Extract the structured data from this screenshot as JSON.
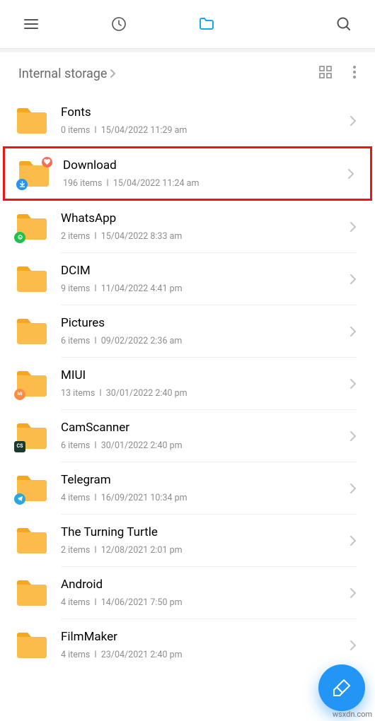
{
  "breadcrumb": "Internal storage",
  "folders": [
    {
      "name": "Fonts",
      "items": "0 items",
      "date": "15/04/2022 11:29 am",
      "badges": [],
      "highlighted": false
    },
    {
      "name": "Download",
      "items": "196 items",
      "date": "15/04/2022 11:24 am",
      "badges": [
        {
          "pos": "tr",
          "color": "#ff6b57",
          "icon": "heart"
        },
        {
          "pos": "bl",
          "color": "#2395f5",
          "icon": "download"
        }
      ],
      "highlighted": true
    },
    {
      "name": "WhatsApp",
      "items": "2 items",
      "date": "15/04/2022 8:33 am",
      "badges": [
        {
          "pos": "bl",
          "color": "#1ec14d",
          "icon": "whatsapp"
        }
      ],
      "highlighted": false
    },
    {
      "name": "DCIM",
      "items": "9 items",
      "date": "11/04/2022 4:41 pm",
      "badges": [],
      "highlighted": false
    },
    {
      "name": "Pictures",
      "items": "6 items",
      "date": "09/02/2022 2:36 am",
      "badges": [],
      "highlighted": false
    },
    {
      "name": "MIUI",
      "items": "13 items",
      "date": "30/01/2022 2:40 pm",
      "badges": [
        {
          "pos": "bl",
          "color": "#ff8c42",
          "icon": "miui"
        }
      ],
      "highlighted": false
    },
    {
      "name": "CamScanner",
      "items": "6 items",
      "date": "30/01/2022 2:40 pm",
      "badges": [
        {
          "pos": "bl",
          "color": "#1b3a2f",
          "icon": "cs"
        }
      ],
      "highlighted": false
    },
    {
      "name": "Telegram",
      "items": "4 items",
      "date": "16/09/2021 10:34 pm",
      "badges": [
        {
          "pos": "bl",
          "color": "#2ba7e0",
          "icon": "telegram"
        }
      ],
      "highlighted": false
    },
    {
      "name": "The Turning Turtle",
      "items": "2 items",
      "date": "12/08/2021 2:01 pm",
      "badges": [],
      "highlighted": false
    },
    {
      "name": "Android",
      "items": "4 items",
      "date": "14/06/2021 7:50 pm",
      "badges": [],
      "highlighted": false
    },
    {
      "name": "FilmMaker",
      "items": "4 items",
      "date": "23/04/2021 2:40 pm",
      "badges": [],
      "highlighted": false
    }
  ],
  "watermark": "wsxdn.com"
}
